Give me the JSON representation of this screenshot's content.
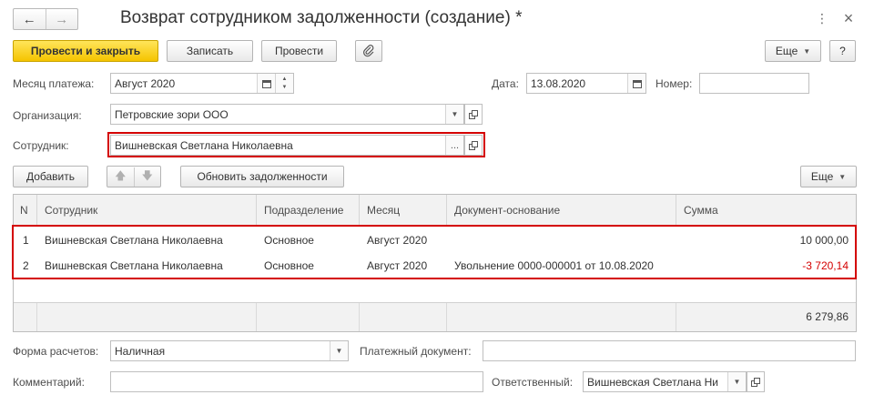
{
  "window": {
    "title": "Возврат сотрудником задолженности (создание) *",
    "more_icon": "⋮",
    "close_icon": "×"
  },
  "toolbar": {
    "post_close": "Провести и закрыть",
    "save": "Записать",
    "post": "Провести",
    "more": "Еще",
    "help": "?"
  },
  "form": {
    "payment_month_label": "Месяц платежа:",
    "payment_month_value": "Август 2020",
    "date_label": "Дата:",
    "date_value": "13.08.2020",
    "number_label": "Номер:",
    "number_value": "",
    "organization_label": "Организация:",
    "organization_value": "Петровские зори ООО",
    "employee_label": "Сотрудник:",
    "employee_value": "Вишневская Светлана Николаевна",
    "ellipsis": "..."
  },
  "table_toolbar": {
    "add": "Добавить",
    "refresh": "Обновить задолженности",
    "more": "Еще"
  },
  "table": {
    "columns": [
      "N",
      "Сотрудник",
      "Подразделение",
      "Месяц",
      "Документ-основание",
      "Сумма"
    ],
    "rows": [
      {
        "n": "1",
        "employee": "Вишневская Светлана Николаевна",
        "department": "Основное",
        "month": "Август 2020",
        "document": "",
        "sum": "10 000,00"
      },
      {
        "n": "2",
        "employee": "Вишневская Светлана Николаевна",
        "department": "Основное",
        "month": "Август 2020",
        "document": "Увольнение 0000-000001 от 10.08.2020",
        "sum": "-3 720,14"
      }
    ],
    "total": "6 279,86"
  },
  "footer": {
    "payment_form_label": "Форма расчетов:",
    "payment_form_value": "Наличная",
    "payment_doc_label": "Платежный документ:",
    "payment_doc_value": "",
    "comment_label": "Комментарий:",
    "comment_value": "",
    "responsible_label": "Ответственный:",
    "responsible_value": "Вишневская Светлана Ни"
  },
  "colors": {
    "primary_button": "#f5c400",
    "highlight_frame": "#d40000",
    "negative_amount": "#d40000"
  }
}
